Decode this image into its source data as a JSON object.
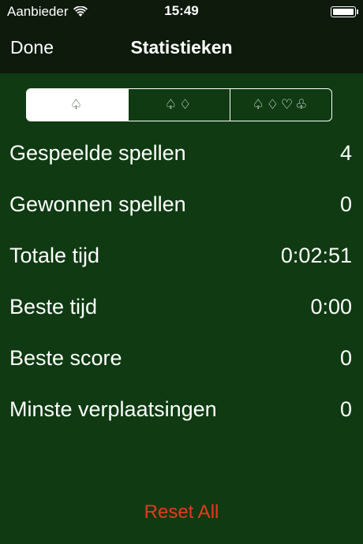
{
  "status": {
    "carrier": "Aanbieder",
    "time": "15:49",
    "wifi_icon": "wifi-icon",
    "battery_icon": "battery-icon"
  },
  "nav": {
    "done_label": "Done",
    "title": "Statistieken"
  },
  "segments": [
    {
      "label": "♤",
      "selected": true
    },
    {
      "label": "♤♢",
      "selected": false
    },
    {
      "label": "♤♢♡♧",
      "selected": false
    }
  ],
  "stats": [
    {
      "label": "Gespeelde spellen",
      "value": "4"
    },
    {
      "label": "Gewonnen spellen",
      "value": "0"
    },
    {
      "label": "Totale tijd",
      "value": "0:02:51"
    },
    {
      "label": "Beste tijd",
      "value": "0:00"
    },
    {
      "label": "Beste score",
      "value": "0"
    },
    {
      "label": "Minste verplaatsingen",
      "value": "0"
    }
  ],
  "reset_label": "Reset All",
  "colors": {
    "background": "#0f3a12",
    "bar": "#0d1a0c",
    "accent_red": "#e53a1e"
  }
}
